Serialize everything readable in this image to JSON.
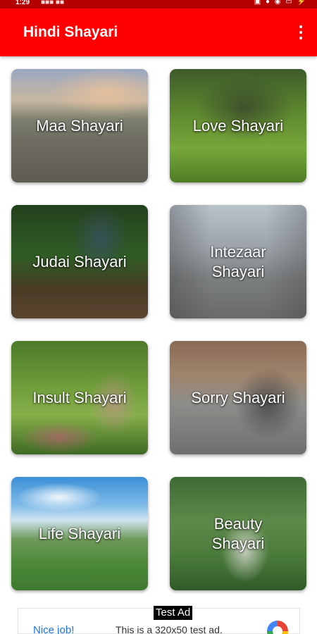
{
  "status_bar": {
    "time": "1:29",
    "netspeed": "■■■ ■■",
    "icons": "▣ ● ◉ ▭ ⚡"
  },
  "app_bar": {
    "title": "Hindi Shayari",
    "menu_icon": "overflow-menu-icon"
  },
  "categories": [
    {
      "label": "Maa Shayari",
      "image": "family-walking-road"
    },
    {
      "label": "Love Shayari",
      "image": "couple-on-grass"
    },
    {
      "label": "Judai Shayari",
      "image": "couple-in-forest"
    },
    {
      "label": "Intezaar Shayari",
      "image": "woman-sitting-street"
    },
    {
      "label": "Insult Shayari",
      "image": "girl-in-garden"
    },
    {
      "label": "Sorry Shayari",
      "image": "man-kneeling-to-woman"
    },
    {
      "label": "Life Shayari",
      "image": "man-on-hill-clouds"
    },
    {
      "label": "Beauty Shayari",
      "image": "woman-with-flower"
    }
  ],
  "ad": {
    "badge": "Test Ad",
    "headline": "Nice job!",
    "description": "This is a 320x50 test ad.",
    "logo": "admob-logo-icon"
  },
  "colors": {
    "app_bar": "#ff0000",
    "status_bar": "#b50000",
    "card_text": "#ffffff",
    "ad_link": "#1a73e8"
  }
}
